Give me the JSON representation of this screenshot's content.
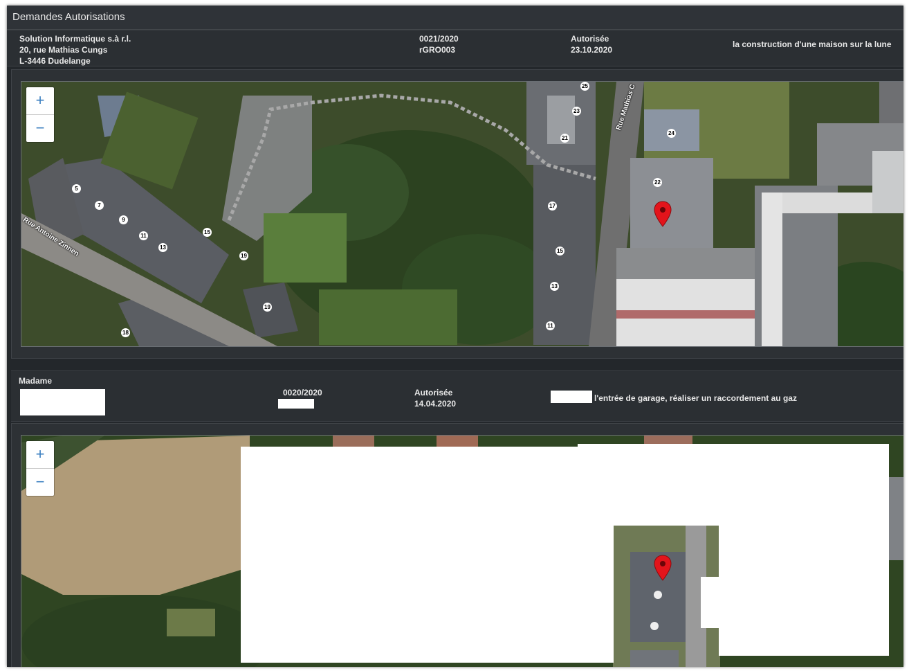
{
  "window": {
    "title": "Demandes Autorisations"
  },
  "records": [
    {
      "applicant_lines": [
        "Solution Informatique s.à r.l.",
        "20, rue Mathias Cungs",
        "L-3446 Dudelange"
      ],
      "reference": "0021/2020",
      "code": "rGRO003",
      "status": "Autorisée",
      "date": "23.10.2020",
      "description": "la construction d'une maison sur la lune",
      "map": {
        "zoom_in": "+",
        "zoom_out": "−",
        "street_labels": [
          "Rue Antoine Zinnen",
          "Rue Mathias C"
        ],
        "house_numbers": [
          "5",
          "7",
          "9",
          "11",
          "13",
          "15",
          "19",
          "19",
          "18",
          "25",
          "23",
          "21",
          "24",
          "22",
          "17",
          "15",
          "13",
          "11"
        ]
      }
    },
    {
      "applicant_lines": [
        "Madame"
      ],
      "reference": "0020/2020",
      "status": "Autorisée",
      "date": "14.04.2020",
      "description": "l'entrée de garage, réaliser un raccordement au gaz",
      "map": {
        "zoom_in": "+",
        "zoom_out": "−"
      }
    }
  ],
  "colors": {
    "marker": "#e3141b",
    "zoom_glyph": "#3a7ec0",
    "window_bg": "#23272b"
  }
}
